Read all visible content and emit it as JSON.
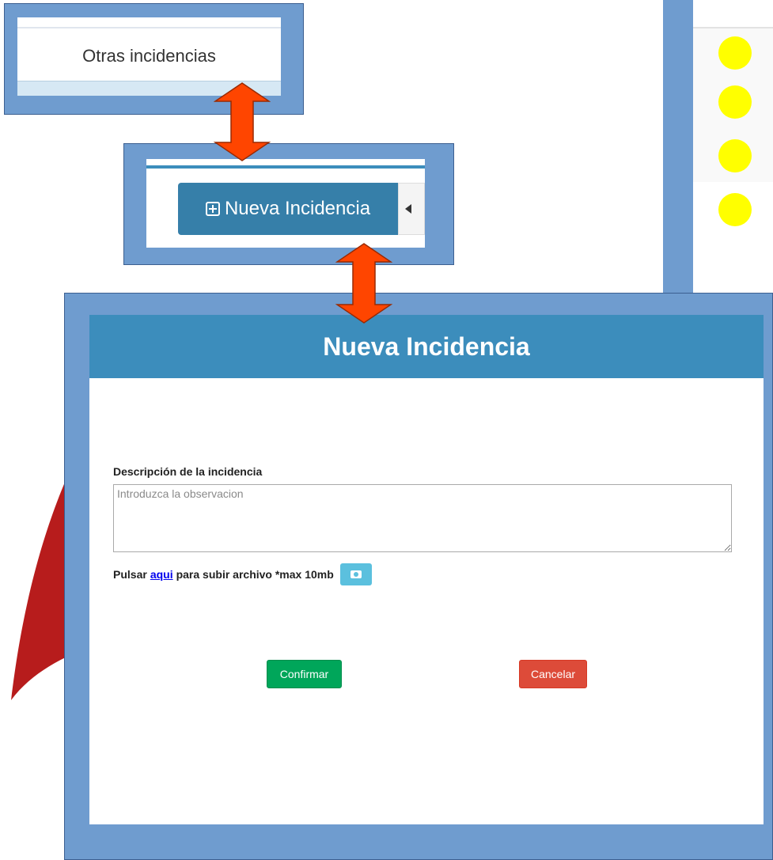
{
  "callout_top": {
    "label": "Otras incidencias"
  },
  "callout_middle": {
    "button_label": "Nueva Incidencia"
  },
  "modal": {
    "title": "Nueva Incidencia",
    "description_label": "Descripción de la incidencia",
    "description_placeholder": "Introduzca la observacion",
    "upload_prefix": "Pulsar",
    "upload_link": "aqui",
    "upload_suffix": "para subir archivo *max 10mb",
    "confirm_label": "Confirmar",
    "cancel_label": "Cancelar"
  },
  "icons": {
    "plus": "plus-square-icon",
    "camera": "camera-icon",
    "arrow": "double-arrow-icon",
    "status": "yellow-status-dot-icon"
  },
  "colors": {
    "frame": "#6f9ccf",
    "header": "#3c8dbc",
    "arrow": "#ff4500",
    "confirm": "#00a65a",
    "cancel": "#dd4b39",
    "status_dot": "#ffff00",
    "upload_button": "#5bc0de"
  }
}
